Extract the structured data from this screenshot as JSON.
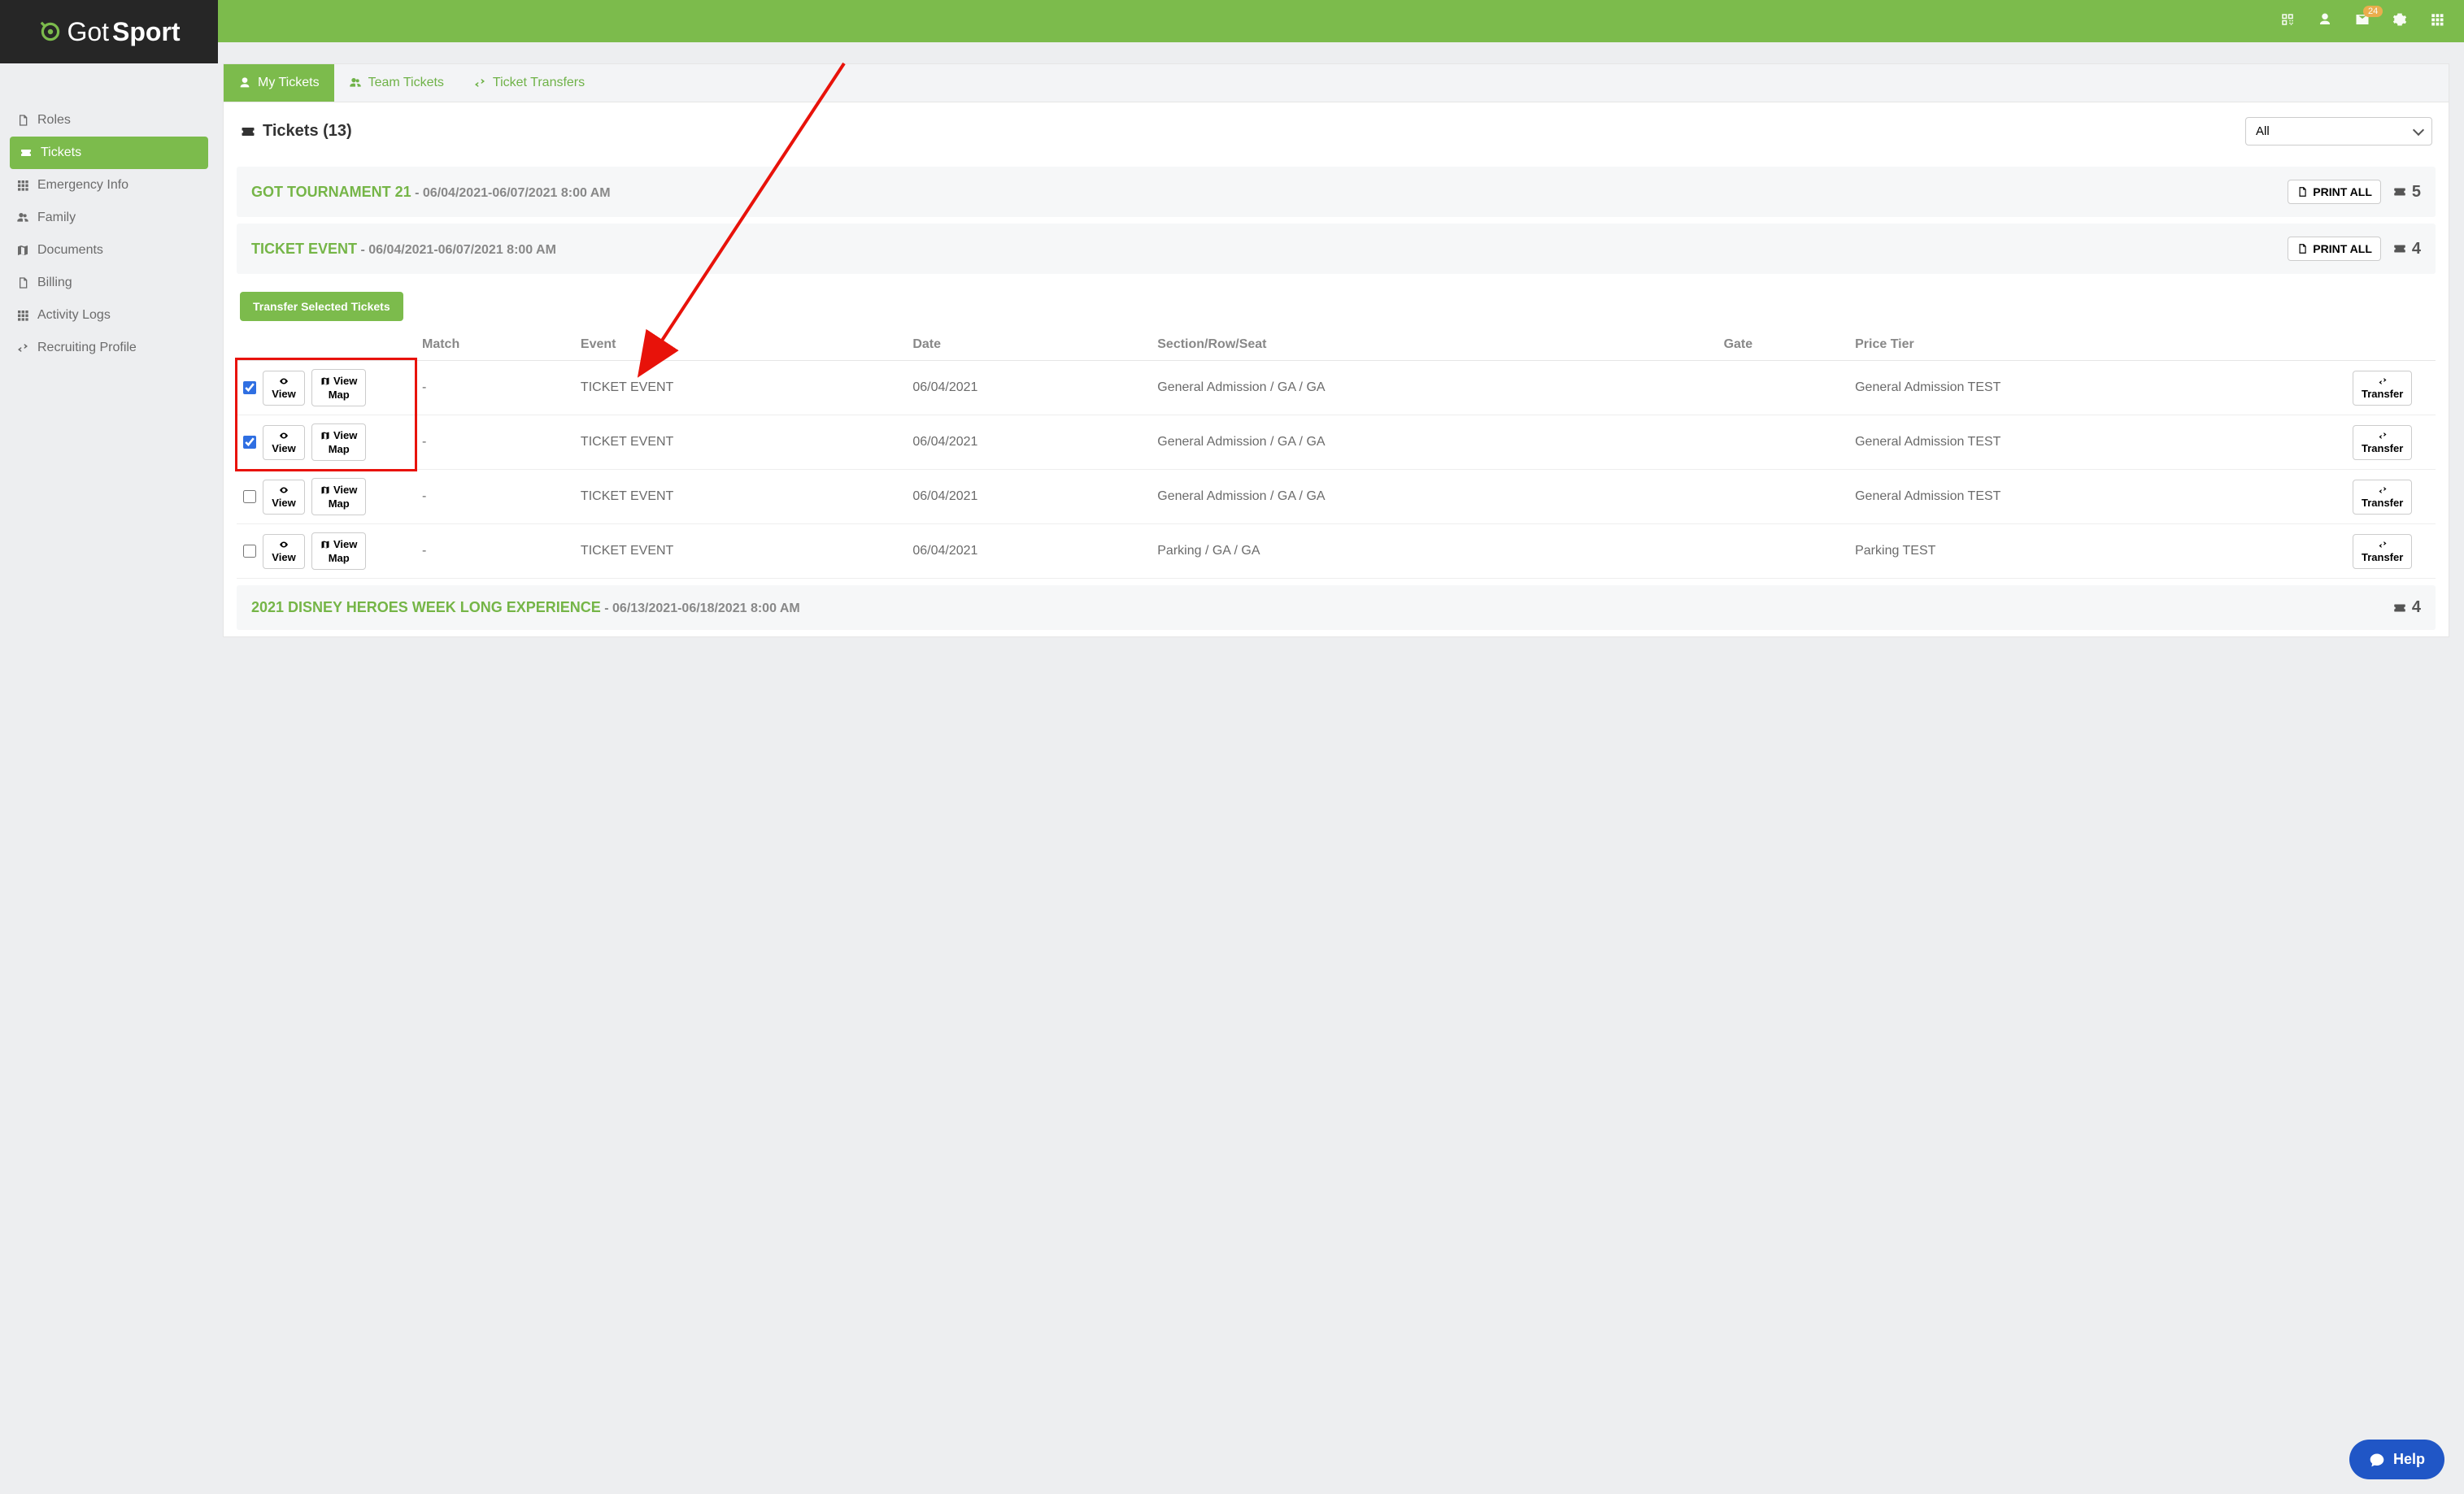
{
  "brand": {
    "part1": "Got",
    "part2": "Sport"
  },
  "topbar": {
    "notification_count": "24"
  },
  "sidebar": {
    "items": [
      {
        "label": "Roles",
        "icon": "id-card-icon"
      },
      {
        "label": "Tickets",
        "icon": "ticket-icon",
        "active": true
      },
      {
        "label": "Emergency Info",
        "icon": "plus-square-icon"
      },
      {
        "label": "Family",
        "icon": "sitemap-icon"
      },
      {
        "label": "Documents",
        "icon": "folder-icon"
      },
      {
        "label": "Billing",
        "icon": "credit-card-icon"
      },
      {
        "label": "Activity Logs",
        "icon": "archive-icon"
      },
      {
        "label": "Recruiting Profile",
        "icon": "share-icon"
      }
    ]
  },
  "tabs": [
    {
      "label": "My Tickets",
      "icon": "user-icon",
      "active": true
    },
    {
      "label": "Team Tickets",
      "icon": "users-icon"
    },
    {
      "label": "Ticket Transfers",
      "icon": "exchange-icon"
    }
  ],
  "page": {
    "title": "Tickets (13)",
    "filter_selected": "All",
    "transfer_selected_label": "Transfer Selected Tickets"
  },
  "events": [
    {
      "name": "GOT TOURNAMENT 21",
      "datespan": " - 06/04/2021-06/07/2021 8:00 AM",
      "print_label": "PRINT ALL",
      "count": "5"
    },
    {
      "name": "TICKET EVENT",
      "datespan": " - 06/04/2021-06/07/2021 8:00 AM",
      "print_label": "PRINT ALL",
      "count": "4"
    },
    {
      "name": "2021 DISNEY HEROES WEEK LONG EXPERIENCE",
      "datespan": " - 06/13/2021-06/18/2021 8:00 AM",
      "count": "4"
    }
  ],
  "columns": [
    "Match",
    "Event",
    "Date",
    "Section/Row/Seat",
    "Gate",
    "Price Tier"
  ],
  "buttons": {
    "view": "View",
    "view_map": "View Map",
    "transfer": "Transfer"
  },
  "rows": [
    {
      "checked": true,
      "match": "-",
      "event": "TICKET EVENT",
      "date": "06/04/2021",
      "srs": "General Admission / GA / GA",
      "gate": "",
      "tier": "General Admission TEST"
    },
    {
      "checked": true,
      "match": "-",
      "event": "TICKET EVENT",
      "date": "06/04/2021",
      "srs": "General Admission / GA / GA",
      "gate": "",
      "tier": "General Admission TEST"
    },
    {
      "checked": false,
      "match": "-",
      "event": "TICKET EVENT",
      "date": "06/04/2021",
      "srs": "General Admission / GA / GA",
      "gate": "",
      "tier": "General Admission TEST"
    },
    {
      "checked": false,
      "match": "-",
      "event": "TICKET EVENT",
      "date": "06/04/2021",
      "srs": "Parking / GA / GA",
      "gate": "",
      "tier": "Parking TEST"
    }
  ],
  "help": {
    "label": "Help"
  }
}
